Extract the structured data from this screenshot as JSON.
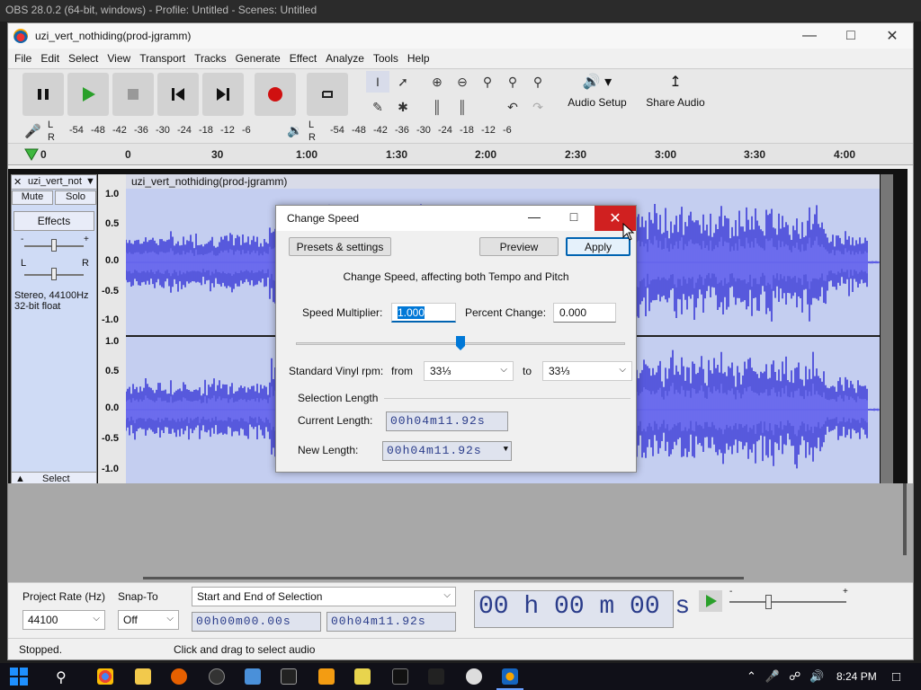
{
  "obs_title": "OBS 28.0.2 (64-bit, windows) - Profile: Untitled - Scenes: Untitled",
  "window": {
    "title": "uzi_vert_nothiding(prod-jgramm)"
  },
  "menu": [
    "File",
    "Edit",
    "Select",
    "View",
    "Transport",
    "Tracks",
    "Generate",
    "Effect",
    "Analyze",
    "Tools",
    "Help"
  ],
  "toolbar": {
    "audio_setup": "Audio Setup",
    "share_audio": "Share Audio"
  },
  "meter_labels": [
    "-54",
    "-48",
    "-42",
    "-36",
    "-30",
    "-24",
    "-18",
    "-12",
    "-6"
  ],
  "lr": {
    "l": "L",
    "r": "R"
  },
  "ruler": [
    "0",
    "30",
    "1:00",
    "1:30",
    "2:00",
    "2:30",
    "3:00",
    "3:30",
    "4:00"
  ],
  "track": {
    "name": "uzi_vert_not",
    "clip_name": "uzi_vert_nothiding(prod-jgramm)",
    "mute": "Mute",
    "solo": "Solo",
    "effects": "Effects",
    "gain_plus": "+",
    "gain_minus": "-",
    "pan_l": "L",
    "pan_r": "R",
    "info_line1": "Stereo, 44100Hz",
    "info_line2": "32-bit float",
    "select": "Select",
    "scale": [
      "1.0",
      "0.5",
      "0.0",
      "-0.5",
      "-1.0"
    ]
  },
  "dialog": {
    "title": "Change Speed",
    "presets": "Presets & settings",
    "preview": "Preview",
    "apply": "Apply",
    "description": "Change Speed, affecting both Tempo and Pitch",
    "speed_label": "Speed Multiplier:",
    "speed_value": "1.000",
    "percent_label": "Percent Change:",
    "percent_value": "0.000",
    "slider_position": 0.5,
    "vinyl_label": "Standard Vinyl rpm:",
    "from_label": "from",
    "from_value": "33⅓",
    "to_label": "to",
    "to_value": "33⅓",
    "selection_length": "Selection Length",
    "current_length_label": "Current Length:",
    "current_length": "00h04m11.92s",
    "new_length_label": "New Length:",
    "new_length": "00h04m11.92s"
  },
  "bottom": {
    "project_rate_label": "Project Rate (Hz)",
    "project_rate": "44100",
    "snap_label": "Snap-To",
    "snap_value": "Off",
    "selection_mode": "Start and End of Selection",
    "sel_start": "00h00m00.00s",
    "sel_end": "00h04m11.92s",
    "position": "00 h 00 m 00 s",
    "playback_minus": "-",
    "playback_plus": "+"
  },
  "status": {
    "left": "Stopped.",
    "hint": "Click and drag to select audio"
  },
  "clock": "8:24 PM",
  "colors": {
    "wave": "#3c3cd8",
    "wave_rms": "#6a6af0",
    "close_red": "#d02020",
    "accent": "#0063b1"
  }
}
